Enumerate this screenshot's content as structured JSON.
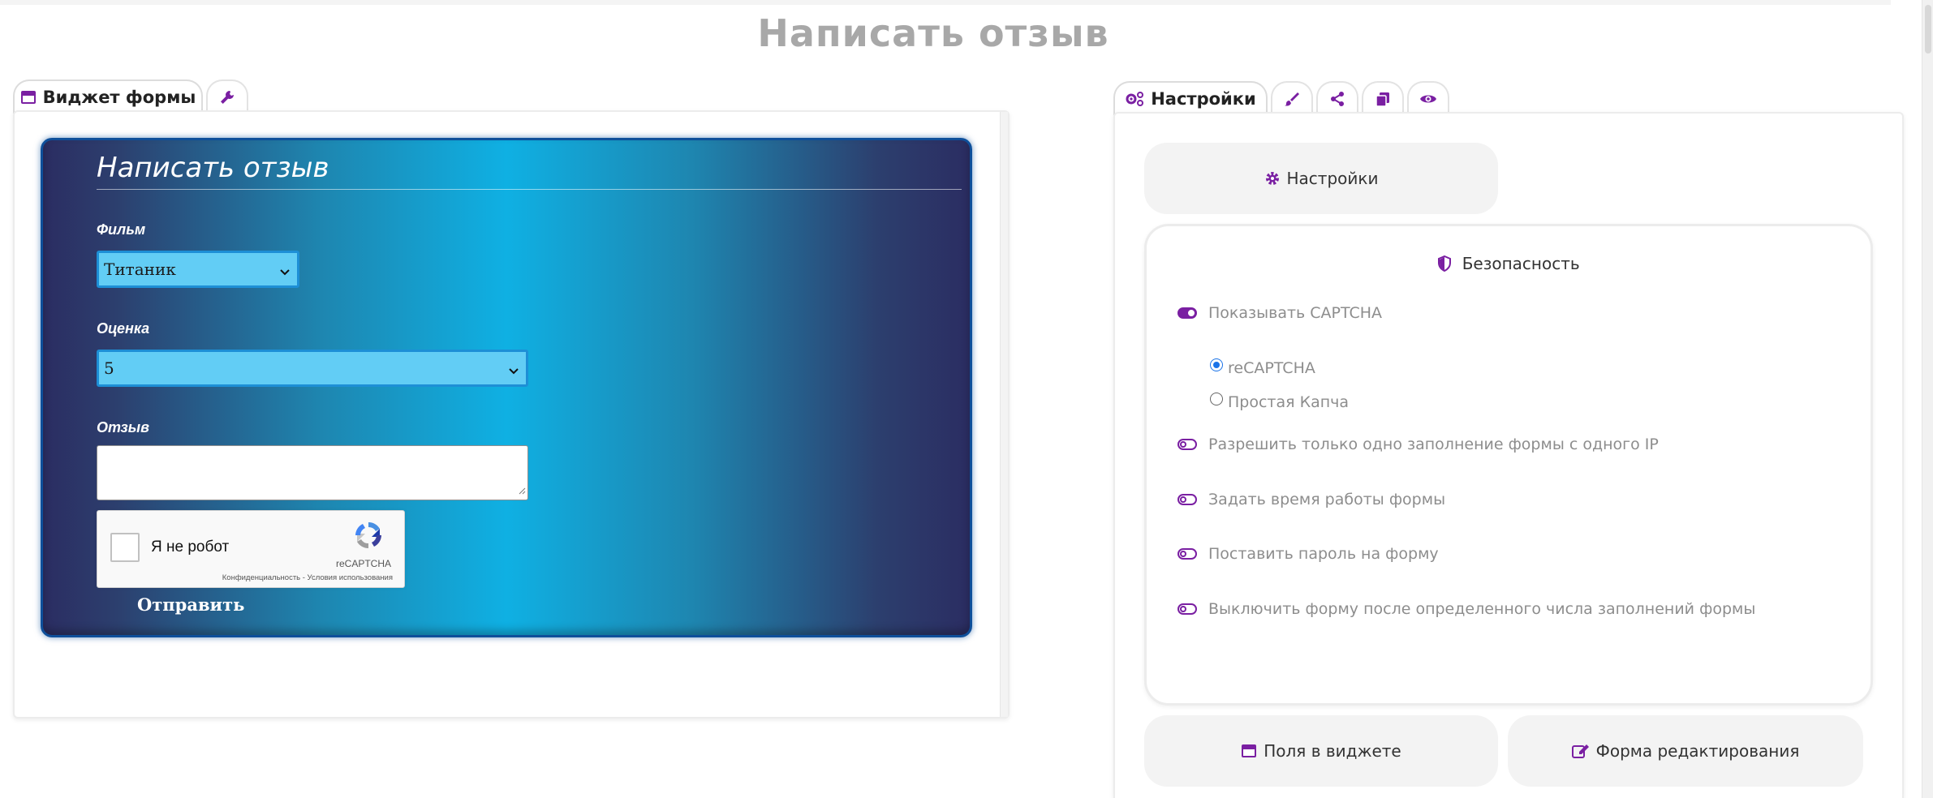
{
  "page": {
    "title": "Написать отзыв"
  },
  "left_tabs": {
    "widget_label": "Виджет формы",
    "tools_icon": "wrench-icon"
  },
  "form_widget": {
    "title": "Написать отзыв",
    "film_label": "Фильм",
    "film_value": "Титаник",
    "rating_label": "Оценка",
    "rating_value": "5",
    "review_label": "Отзыв",
    "review_value": "",
    "captcha": {
      "checkbox_label": "Я не робот",
      "brand": "reCAPTCHA",
      "links": "Конфиденциальность - Условия использования"
    },
    "submit_label": "Отправить",
    "colors": {
      "border": "#0e4f9a",
      "gradient_center": "#0fb0e3",
      "gradient_edge": "#2b2d62",
      "select_bg": "#62cdf5"
    }
  },
  "right_tabs": {
    "settings_label": "Настройки",
    "icons": [
      "brush-icon",
      "share-icon",
      "copy-icon",
      "eye-icon"
    ]
  },
  "settings": {
    "settings_button": "Настройки",
    "security_title": "Безопасность",
    "show_captcha": {
      "label": "Показывать CAPTCHA",
      "on": true
    },
    "captcha_types": [
      {
        "label": "reCAPTCHA",
        "checked": true
      },
      {
        "label": "Простая Капча",
        "checked": false
      }
    ],
    "options": [
      {
        "label": "Разрешить только одно заполнение формы с одного IP",
        "on": false
      },
      {
        "label": "Задать время работы формы",
        "on": false
      },
      {
        "label": "Поставить пароль на форму",
        "on": false
      },
      {
        "label": "Выключить форму после определенного числа заполнений формы",
        "on": false
      }
    ],
    "fields_button": "Поля в виджете",
    "edit_form_button": "Форма редактирования"
  },
  "accent_color": "#7a1fa2"
}
